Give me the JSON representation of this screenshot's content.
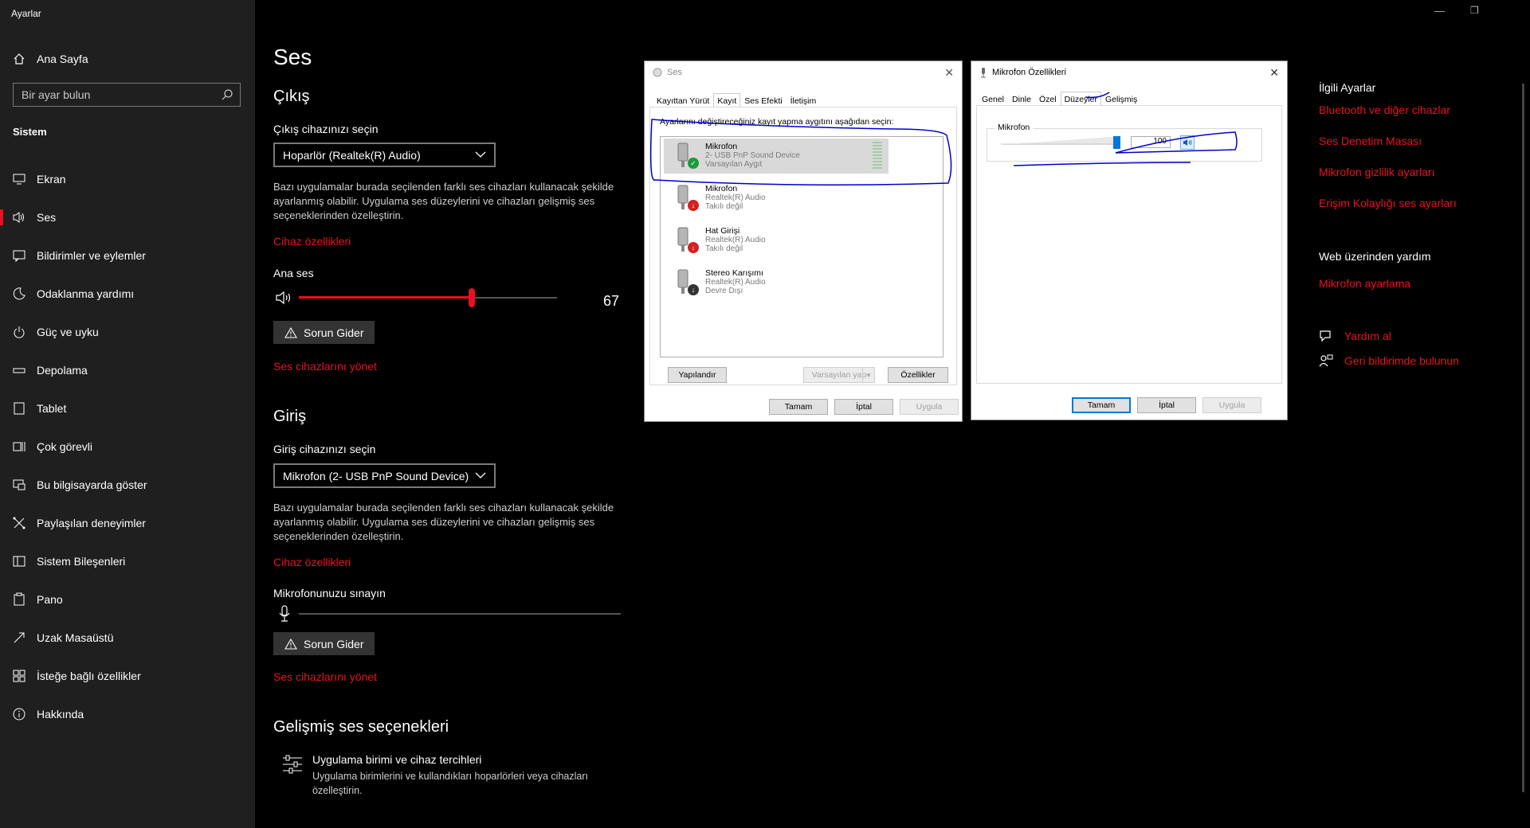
{
  "window": {
    "app_title": "Ayarlar"
  },
  "sidebar": {
    "home_label": "Ana Sayfa",
    "search_placeholder": "Bir ayar bulun",
    "section_label": "Sistem",
    "items": [
      {
        "label": "Ekran",
        "icon": "monitor-icon"
      },
      {
        "label": "Ses",
        "icon": "speaker-icon",
        "active": true
      },
      {
        "label": "Bildirimler ve eylemler",
        "icon": "notification-icon"
      },
      {
        "label": "Odaklanma yardımı",
        "icon": "moon-icon"
      },
      {
        "label": "Güç ve uyku",
        "icon": "power-icon"
      },
      {
        "label": "Depolama",
        "icon": "storage-icon"
      },
      {
        "label": "Tablet",
        "icon": "tablet-icon"
      },
      {
        "label": "Çok görevli",
        "icon": "multitask-icon"
      },
      {
        "label": "Bu bilgisayarda göster",
        "icon": "project-icon"
      },
      {
        "label": "Paylaşılan deneyimler",
        "icon": "share-icon"
      },
      {
        "label": "Sistem Bileşenleri",
        "icon": "components-icon"
      },
      {
        "label": "Pano",
        "icon": "clipboard-icon"
      },
      {
        "label": "Uzak Masaüstü",
        "icon": "remote-icon"
      },
      {
        "label": "İsteğe bağlı özellikler",
        "icon": "features-icon"
      },
      {
        "label": "Hakkında",
        "icon": "info-icon"
      }
    ]
  },
  "main": {
    "title": "Ses",
    "output": {
      "heading": "Çıkış",
      "select_label": "Çıkış cihazınızı seçin",
      "selected": "Hoparlör (Realtek(R) Audio)",
      "description": "Bazı uygulamalar burada seçilenden farklı ses cihazları kullanacak şekilde ayarlanmış olabilir. Uygulama ses düzeylerini ve cihazları gelişmiş ses seçeneklerinden özelleştirin.",
      "device_props_link": "Cihaz özellikleri",
      "volume_label": "Ana ses",
      "volume_value": "67",
      "volume_fraction": 0.67,
      "troubleshoot": "Sorun Gider",
      "manage_link": "Ses cihazlarını yönet"
    },
    "input": {
      "heading": "Giriş",
      "select_label": "Giriş cihazınızı seçin",
      "selected": "Mikrofon (2- USB PnP Sound Device)",
      "description": "Bazı uygulamalar burada seçilenden farklı ses cihazları kullanacak şekilde ayarlanmış olabilir. Uygulama ses düzeylerini ve cihazları gelişmiş ses seçeneklerinden özelleştirin.",
      "device_props_link": "Cihaz özellikleri",
      "test_label": "Mikrofonunuzu sınayın",
      "troubleshoot": "Sorun Gider",
      "manage_link": "Ses cihazlarını yönet"
    },
    "advanced": {
      "heading": "Gelişmiş ses seçenekleri",
      "item_title": "Uygulama birimi ve cihaz tercihleri",
      "item_desc": "Uygulama birimlerini ve kullandıkları hoparlörleri veya cihazları özelleştirin."
    }
  },
  "related": {
    "heading": "İlgili Ayarlar",
    "links": [
      "Bluetooth ve diğer cihazlar",
      "Ses Denetim Masası",
      "Mikrofon gizlilik ayarları",
      "Erişim Kolaylığı ses ayarları"
    ],
    "web_heading": "Web üzerinden yardım",
    "web_links": [
      "Mikrofon ayarlama"
    ],
    "help": "Yardım al",
    "feedback": "Geri bildirimde bulunun"
  },
  "sound_dialog": {
    "title": "Ses",
    "tabs": [
      "Kayıttan Yürüt",
      "Kayıt",
      "Ses Efekti",
      "İletişim"
    ],
    "selected_tab": 1,
    "instruction": "Ayarlarını değiştireceğiniz kayıt yapma aygıtını aşağıdan seçin:",
    "devices": [
      {
        "name": "Mikrofon",
        "line1": "2- USB PnP Sound Device",
        "line2": "Varsayılan Aygıt",
        "selected": true,
        "status": "ok"
      },
      {
        "name": "Mikrofon",
        "line1": "Realtek(R) Audio",
        "line2": "Takılı değil",
        "status": "down"
      },
      {
        "name": "Hat Girişi",
        "line1": "Realtek(R) Audio",
        "line2": "Takılı değil",
        "status": "down"
      },
      {
        "name": "Stereo Karışımı",
        "line1": "Realtek(R) Audio",
        "line2": "Devre Dışı",
        "status": "disabled"
      }
    ],
    "configure": "Yapılandır",
    "set_default": "Varsayılan yap",
    "properties": "Özellikler",
    "ok": "Tamam",
    "cancel": "İptal",
    "apply": "Uygula"
  },
  "mic_dialog": {
    "title": "Mikrofon Özellikleri",
    "tabs": [
      "Genel",
      "Dinle",
      "Özel",
      "Düzeyler",
      "Gelişmiş"
    ],
    "selected_tab": 3,
    "group_label": "Mikrofon",
    "level_value": "100",
    "level_fraction": 1.0,
    "ok": "Tamam",
    "cancel": "İptal",
    "apply": "Uygula"
  },
  "colors": {
    "accent": "#e81123",
    "sidebar_bg": "#1f1f1f",
    "annotation": "#0000cc"
  }
}
